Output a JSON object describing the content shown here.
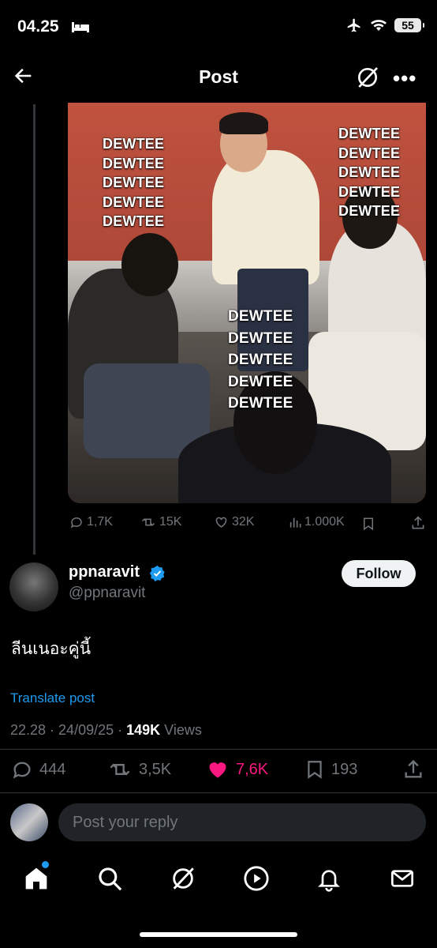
{
  "status_bar": {
    "time": "04.25",
    "battery": "55"
  },
  "header": {
    "title": "Post"
  },
  "quoted_media": {
    "captions": [
      "DEWTEE\nDEWTEE\nDEWTEE\nDEWTEE\nDEWTEE",
      "DEWTEE\nDEWTEE\nDEWTEE\nDEWTEE\nDEWTEE",
      "DEWTEE\nDEWTEE\nDEWTEE\nDEWTEE\nDEWTEE"
    ]
  },
  "parent_actions": {
    "replies": "1,7K",
    "reposts": "15K",
    "likes": "32K",
    "views": "1.000K"
  },
  "author": {
    "display_name": "ppnaravit",
    "handle": "@ppnaravit",
    "follow_label": "Follow"
  },
  "post": {
    "text": "ลีนเนอะคู่นี้",
    "translate_label": "Translate post",
    "time": "22.28",
    "date": "24/09/25",
    "views_count": "149K",
    "views_label": "Views"
  },
  "actions": {
    "replies": "444",
    "reposts": "3,5K",
    "likes": "7,6K",
    "bookmarks": "193"
  },
  "reply": {
    "placeholder": "Post your reply"
  },
  "colors": {
    "accent": "#1d9bf0",
    "like": "#f91880",
    "muted": "#71767b"
  }
}
